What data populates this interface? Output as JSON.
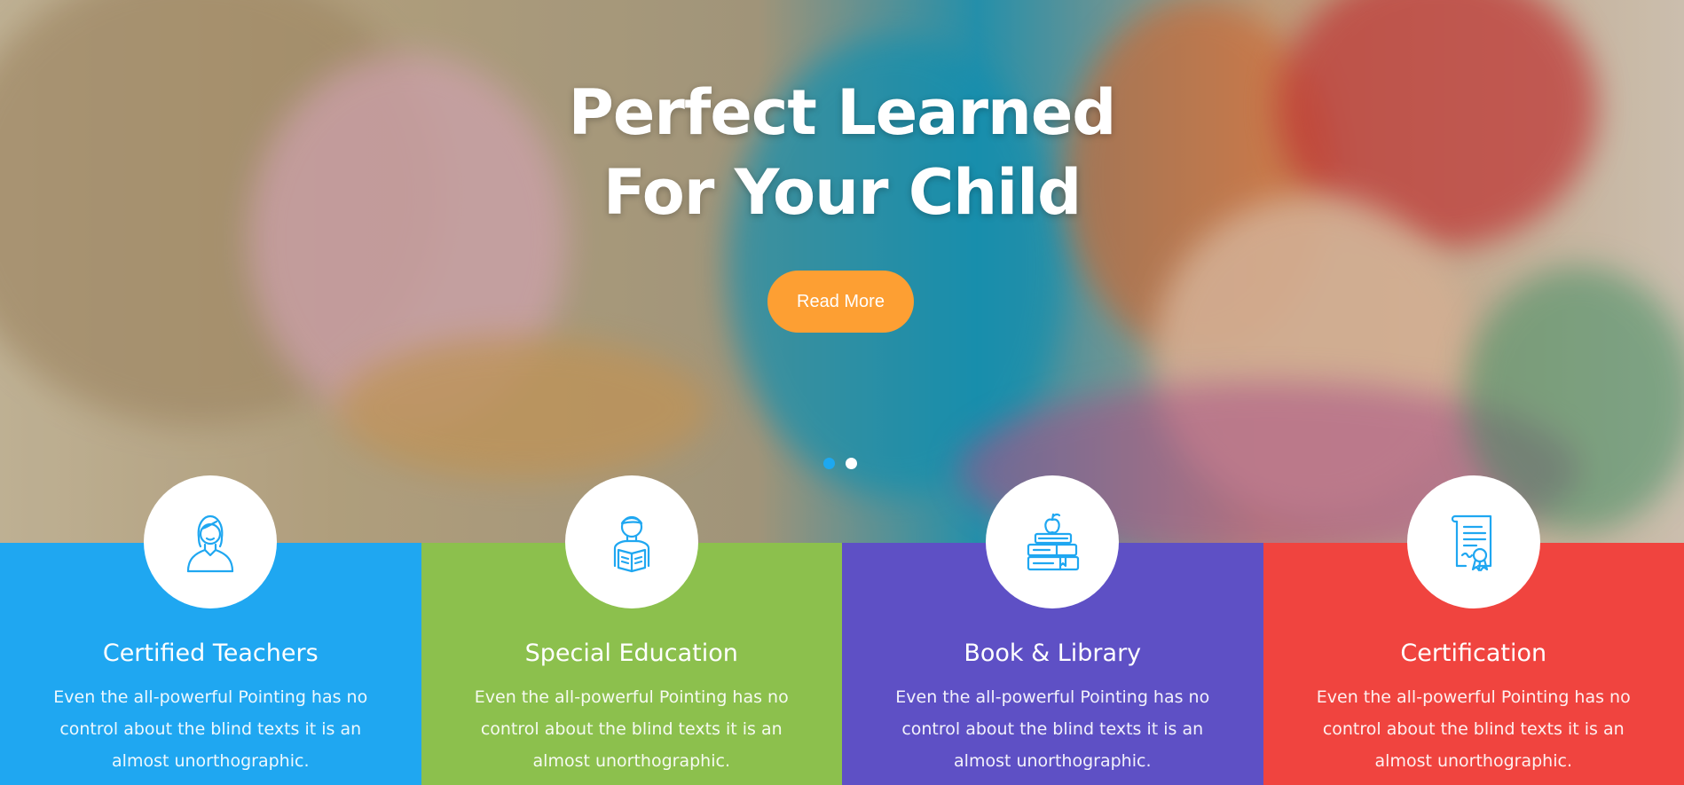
{
  "hero": {
    "title_line1": "Perfect Learned",
    "title_line2": "For Your Child",
    "button_label": "Read More",
    "slides": 2,
    "active_slide": 1
  },
  "features": [
    {
      "title": "Certified Teachers",
      "text": "Even the all-powerful Pointing has no control about the blind texts it is an almost unorthographic.",
      "icon": "teacher-icon",
      "color": "#1fa7f1"
    },
    {
      "title": "Special Education",
      "text": "Even the all-powerful Pointing has no control about the blind texts it is an almost unorthographic.",
      "icon": "student-reading-icon",
      "color": "#8cc04d"
    },
    {
      "title": "Book & Library",
      "text": "Even the all-powerful Pointing has no control about the blind texts it is an almost unorthographic.",
      "icon": "books-apple-icon",
      "color": "#5e50c5"
    },
    {
      "title": "Certification",
      "text": "Even the all-powerful Pointing has no control about the blind texts it is an almost unorthographic.",
      "icon": "certificate-icon",
      "color": "#f0443f"
    }
  ],
  "colors": {
    "accent_button": "#fd9f33",
    "icon_stroke": "#1fa7f1",
    "active_dot": "#1da8f0"
  }
}
